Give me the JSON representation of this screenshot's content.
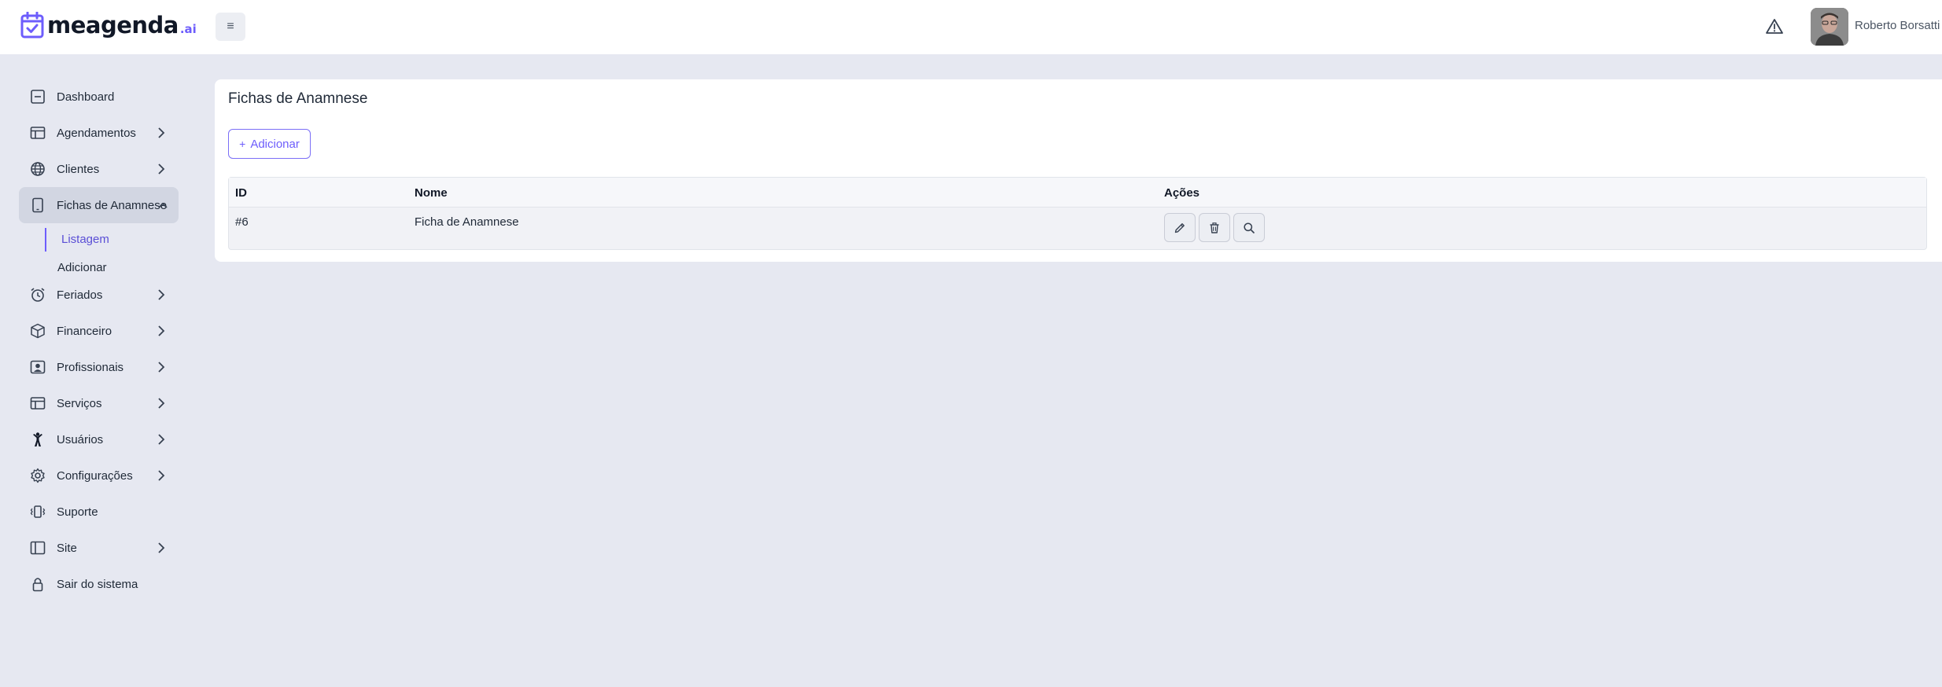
{
  "header": {
    "brand": "meagenda",
    "brand_tld": ".ai",
    "menu_icon": "hamburger-icon",
    "menu_glyph": "≡",
    "alert_icon": "warning-icon",
    "user_name": "Roberto Borsatti"
  },
  "sidebar": {
    "items": [
      {
        "label": "Dashboard",
        "icon": "dashboard-icon"
      },
      {
        "label": "Agendamentos",
        "icon": "table-icon"
      },
      {
        "label": "Clientes",
        "icon": "globe-icon"
      },
      {
        "label": "Fichas de Anamnese",
        "icon": "tablet-icon"
      },
      {
        "label": "Feriados",
        "icon": "alarm-clock-icon"
      },
      {
        "label": "Financeiro",
        "icon": "cube-icon"
      },
      {
        "label": "Profissionais",
        "icon": "person-card-icon"
      },
      {
        "label": "Serviços",
        "icon": "table-icon"
      },
      {
        "label": "Usuários",
        "icon": "person-icon"
      },
      {
        "label": "Configurações",
        "icon": "gear-icon"
      },
      {
        "label": "Suporte",
        "icon": "vibrate-phone-icon"
      },
      {
        "label": "Site",
        "icon": "layout-icon"
      },
      {
        "label": "Sair do sistema",
        "icon": "lock-icon"
      }
    ],
    "submenu": {
      "listagem": "Listagem",
      "adicionar": "Adicionar"
    }
  },
  "main": {
    "title": "Fichas de Anamnese",
    "add_button": "Adicionar",
    "add_button_glyph": "+",
    "table": {
      "columns": [
        "ID",
        "Nome",
        "Ações"
      ],
      "rows": [
        {
          "id": "#6",
          "nome": "Ficha de Anamnese"
        }
      ],
      "actions": [
        "edit-icon",
        "trash-icon",
        "search-icon"
      ]
    }
  },
  "colors": {
    "accent": "#6d5dfc",
    "background": "#e6e8f1",
    "active_nav": "#d2d6e2"
  }
}
